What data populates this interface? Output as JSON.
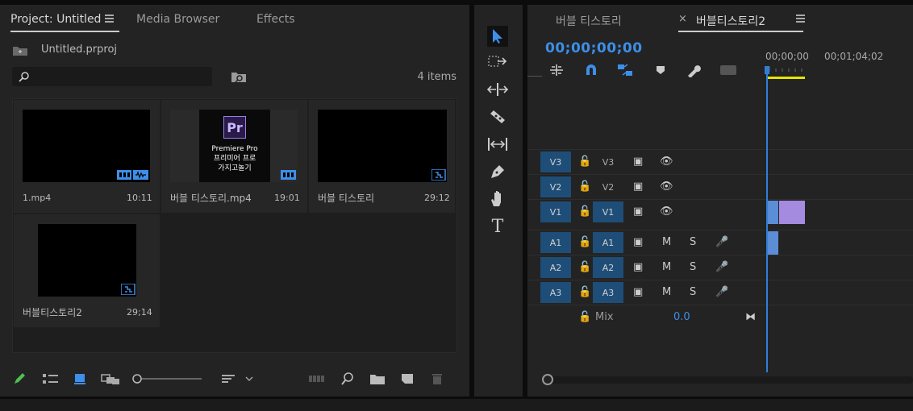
{
  "project_panel": {
    "tabs": [
      {
        "label": "Project: Untitled"
      },
      {
        "label": "Media Browser"
      },
      {
        "label": "Effects"
      }
    ],
    "project_file": "Untitled.prproj",
    "search_placeholder": "",
    "items_count": "4 items",
    "items": [
      {
        "name": "1.mp4",
        "duration": "10:11"
      },
      {
        "name": "버블 티스토리.mp4",
        "duration": "19:01",
        "thumb_lines": [
          "Premiere Pro",
          "프리미어 프로",
          "가지고놀기"
        ],
        "thumb_logo": "Pr"
      },
      {
        "name": "버블 티스토리",
        "duration": "29:12"
      },
      {
        "name": "버블티스토리2",
        "duration": "29;14"
      }
    ]
  },
  "timeline_panel": {
    "tabs": [
      {
        "label": "버블 티스토리"
      },
      {
        "label": "버블티스토리2"
      }
    ],
    "close_glyph": "×",
    "timecode": "00;00;00;00",
    "ruler_times": [
      "00;00;00",
      "00;01;04;02"
    ],
    "tracks": [
      {
        "src": "V3",
        "tgt": "V3"
      },
      {
        "src": "V2",
        "tgt": "V2"
      },
      {
        "src": "V1",
        "tgt": "V1"
      },
      {
        "src": "A1",
        "tgt": "A1"
      },
      {
        "src": "A2",
        "tgt": "A2"
      },
      {
        "src": "A3",
        "tgt": "A3"
      }
    ],
    "audio_btn_m": "M",
    "audio_btn_s": "S",
    "mix_label": "Mix",
    "mix_value": "0.0"
  },
  "tools_panel": {
    "text_tool": "T"
  },
  "colors": {
    "accent": "#3d8fe9",
    "track_blue": "#1e4e78",
    "clip_video": "#a58be0",
    "clip_audio": "#5b8ed6",
    "work_area": "#e5e500"
  }
}
